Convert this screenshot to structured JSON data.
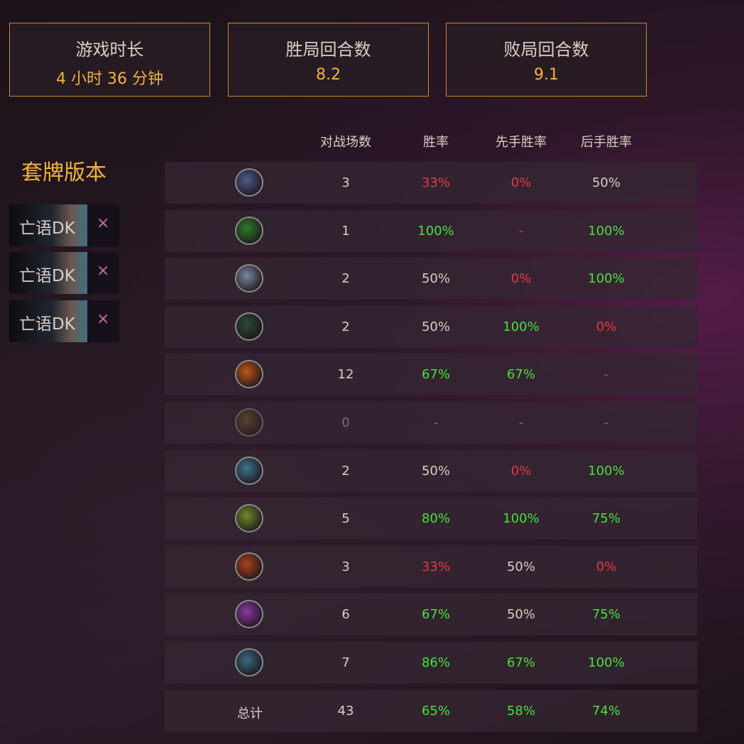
{
  "stats": [
    {
      "title": "游戏时长",
      "value": "4 小时 36 分钟"
    },
    {
      "title": "胜局回合数",
      "value": "8.2"
    },
    {
      "title": "败局回合数",
      "value": "9.1"
    }
  ],
  "decks": {
    "heading": "套牌版本",
    "remove_symbol": "×",
    "items": [
      {
        "name": "亡语DK"
      },
      {
        "name": "亡语DK"
      },
      {
        "name": "亡语DK"
      }
    ]
  },
  "table": {
    "headers": [
      "对战场数",
      "胜率",
      "先手胜率",
      "后手胜率"
    ],
    "rows": [
      {
        "icon": "class-icon-1",
        "icon_color": "#4f5b8a",
        "games": "3",
        "winrate": "33%",
        "first": "0%",
        "second": "50%"
      },
      {
        "icon": "class-icon-2",
        "icon_color": "#2f7a2a",
        "games": "1",
        "winrate": "100%",
        "first": "-",
        "second": "100%"
      },
      {
        "icon": "class-icon-3",
        "icon_color": "#7a86a0",
        "games": "2",
        "winrate": "50%",
        "first": "0%",
        "second": "100%"
      },
      {
        "icon": "class-icon-4",
        "icon_color": "#2c4a3a",
        "games": "2",
        "winrate": "50%",
        "first": "100%",
        "second": "0%"
      },
      {
        "icon": "class-icon-5",
        "icon_color": "#b8561c",
        "games": "12",
        "winrate": "67%",
        "first": "67%",
        "second": "-"
      },
      {
        "icon": "class-icon-6",
        "icon_color": "#7a5a2a",
        "games": "0",
        "winrate": "-",
        "first": "-",
        "second": "-",
        "dim": true
      },
      {
        "icon": "class-icon-7",
        "icon_color": "#3f7390",
        "games": "2",
        "winrate": "50%",
        "first": "0%",
        "second": "100%"
      },
      {
        "icon": "class-icon-8",
        "icon_color": "#6f8a2a",
        "games": "5",
        "winrate": "80%",
        "first": "100%",
        "second": "75%"
      },
      {
        "icon": "class-icon-9",
        "icon_color": "#a8421c",
        "games": "3",
        "winrate": "33%",
        "first": "50%",
        "second": "0%"
      },
      {
        "icon": "class-icon-10",
        "icon_color": "#8a3aa0",
        "games": "6",
        "winrate": "67%",
        "first": "50%",
        "second": "75%"
      },
      {
        "icon": "class-icon-11",
        "icon_color": "#3a6a80",
        "games": "7",
        "winrate": "86%",
        "first": "67%",
        "second": "100%"
      }
    ],
    "total": {
      "label": "总计",
      "games": "43",
      "winrate": "65%",
      "first": "58%",
      "second": "74%"
    }
  },
  "colors": {
    "win": "#44e23a",
    "lose": "#e03c45",
    "neutral": "#d8cfc4",
    "dim": "#7a6e70",
    "accent": "#f1b240"
  }
}
